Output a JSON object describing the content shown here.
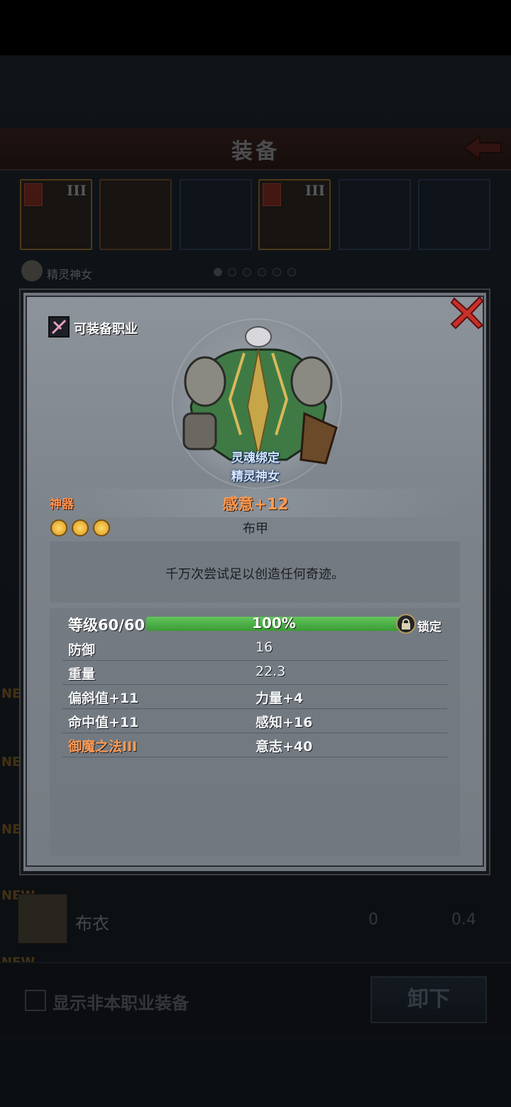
{
  "screen": {
    "title": "装备",
    "character": {
      "name": "精灵神女"
    },
    "pagination": {
      "count": 6,
      "active": 0
    },
    "slots": [
      {
        "tier": "III",
        "color": "orange"
      },
      {
        "tier": "",
        "color": "orange"
      },
      {
        "tier": "",
        "color": "blue"
      },
      {
        "tier": "III",
        "color": "orange"
      },
      {
        "tier": "",
        "color": "blue"
      },
      {
        "tier": "",
        "color": "blue"
      }
    ],
    "new_tags": [
      "NEW",
      "NEW",
      "NEW",
      "NEW",
      "NEW"
    ],
    "list_item": {
      "name": "布衣",
      "value1": "0",
      "value2": "0.4"
    },
    "filter_checkbox": {
      "label": "显示非本职业装备",
      "checked": false
    },
    "unequip_label": "卸下"
  },
  "modal": {
    "class_label": "可装备职业",
    "bind_label": "灵魂绑定",
    "owner_label": "精灵神女",
    "rarity": "神器",
    "item_name": "感意+12",
    "item_type": "布甲",
    "sockets": 3,
    "description": "千万次尝试足以创造任何奇迹。",
    "level": {
      "label": "等级60/60",
      "progress": 1.0,
      "progress_text": "100%",
      "lock_label": "锁定"
    },
    "stats": [
      {
        "left": "防御",
        "right": "16",
        "left_color": "white",
        "right_bold": false
      },
      {
        "left": "重量",
        "right": "22.3",
        "left_color": "white",
        "right_bold": false
      },
      {
        "left": "偏斜值+11",
        "right": "力量+4",
        "left_color": "white",
        "right_bold": true
      },
      {
        "left": "命中值+11",
        "right": "感知+16",
        "left_color": "white",
        "right_bold": true
      },
      {
        "left": "御魔之法III",
        "right": "意志+40",
        "left_color": "orange",
        "right_bold": true
      }
    ]
  },
  "colors": {
    "accent_orange": "#ff9a52",
    "xp_green": "#4fb649",
    "bind_blue": "#d6e6ff"
  }
}
